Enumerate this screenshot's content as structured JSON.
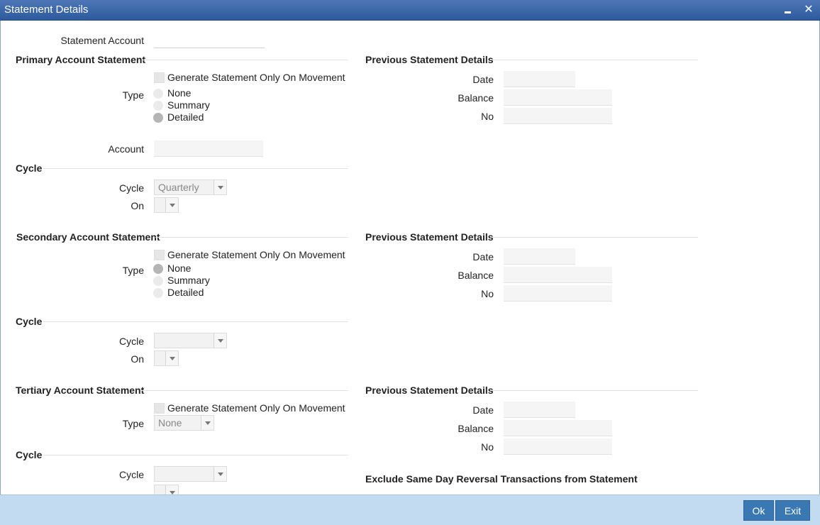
{
  "window": {
    "title": "Statement Details"
  },
  "statement_account": {
    "label": "Statement Account",
    "value": ""
  },
  "primary": {
    "heading": "Primary Account Statement",
    "generate_label": "Generate Statement Only On Movement",
    "type_label": "Type",
    "type_options": [
      "None",
      "Summary",
      "Detailed"
    ],
    "type_selected": "Detailed",
    "account_label": "Account",
    "cycle_heading": "Cycle",
    "cycle_label": "Cycle",
    "cycle_value": "Quarterly",
    "on_label": "On",
    "prev": {
      "heading": "Previous Statement Details",
      "date_label": "Date",
      "balance_label": "Balance",
      "no_label": "No"
    }
  },
  "secondary": {
    "heading": "Secondary Account Statement",
    "generate_label": "Generate Statement Only On Movement",
    "type_label": "Type",
    "type_options": [
      "None",
      "Summary",
      "Detailed"
    ],
    "type_selected": "None",
    "cycle_heading": "Cycle",
    "cycle_label": "Cycle",
    "cycle_value": "",
    "on_label": "On",
    "prev": {
      "heading": "Previous Statement Details",
      "date_label": "Date",
      "balance_label": "Balance",
      "no_label": "No"
    }
  },
  "tertiary": {
    "heading": "Tertiary Account Statement",
    "generate_label": "Generate Statement Only On Movement",
    "type_label": "Type",
    "type_value": "None",
    "cycle_heading": "Cycle",
    "cycle_label": "Cycle",
    "cycle_value": "",
    "prev": {
      "heading": "Previous Statement Details",
      "date_label": "Date",
      "balance_label": "Balance",
      "no_label": "No"
    }
  },
  "exclude_heading": "Exclude Same Day Reversal Transactions from Statement",
  "footer": {
    "ok_label": "Ok",
    "exit_label": "Exit"
  },
  "colors": {
    "titlebar": "#2d5b9e",
    "footer": "#c2dbf1",
    "button": "#3a78b4"
  }
}
